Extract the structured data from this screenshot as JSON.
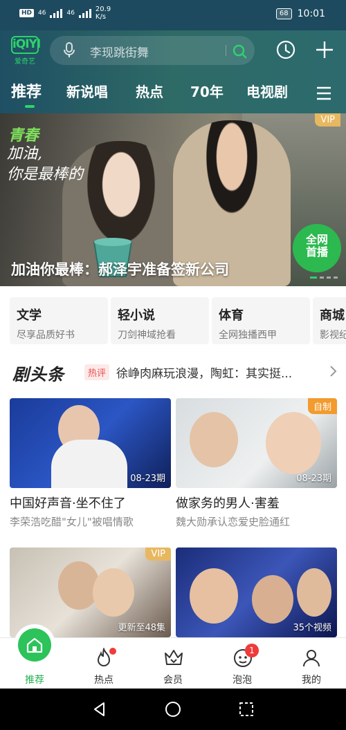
{
  "status_bar": {
    "hd": "HD",
    "sim1": "46",
    "sim2": "46",
    "net_speed_value": "20.9",
    "net_speed_unit": "K/s",
    "battery": "68",
    "time": "10:01"
  },
  "header": {
    "logo_mark": "iQIYI",
    "logo_caption": "爱奇艺",
    "search_placeholder": "李现跳街舞",
    "tabs": [
      {
        "label": "推荐",
        "active": true
      },
      {
        "label": "新说唱"
      },
      {
        "label": "热点"
      },
      {
        "label": "70年"
      },
      {
        "label": "电视剧"
      }
    ]
  },
  "banner": {
    "show_logo": "青春",
    "slogan_line1": "加油,",
    "slogan_line2": "你是最棒的",
    "vip": "VIP",
    "stamp_line1": "全网",
    "stamp_line2": "首播",
    "title": "加油你最棒：郝泽宇准备签新公司"
  },
  "channels": [
    {
      "title": "文学",
      "subtitle": "尽享品质好书"
    },
    {
      "title": "轻小说",
      "subtitle": "刀剑神域抢看"
    },
    {
      "title": "体育",
      "subtitle": "全网独播西甲"
    },
    {
      "title": "商城",
      "subtitle": "影视纪"
    }
  ],
  "headline": {
    "brand": "剧头条",
    "tag": "热评",
    "text": "徐峥肉麻玩浪漫，陶虹：其实挺..."
  },
  "videos": [
    {
      "title": "中国好声音·坐不住了",
      "subtitle": "李荣浩吃醋\"女儿\"被唱情歌",
      "overlay": "08-23期",
      "badge": ""
    },
    {
      "title": "做家务的男人·害羞",
      "subtitle": "魏大勋承认恋爱史脸通红",
      "overlay": "08-23期",
      "badge": "自制"
    },
    {
      "title": "",
      "subtitle": "",
      "overlay": "更新至48集",
      "badge": "VIP"
    },
    {
      "title": "",
      "subtitle": "",
      "overlay": "35个视频",
      "badge": ""
    }
  ],
  "bottom_nav": [
    {
      "label": "推荐",
      "icon": "home-icon",
      "active": true
    },
    {
      "label": "热点",
      "icon": "flame-icon",
      "dot": true
    },
    {
      "label": "会员",
      "icon": "crown-icon"
    },
    {
      "label": "泡泡",
      "icon": "bubble-face-icon",
      "count": "1"
    },
    {
      "label": "我的",
      "icon": "user-icon"
    }
  ],
  "colors": {
    "accent": "#2cd36b",
    "header_bg": "#1f4f63",
    "vip_gold": "#e7b860",
    "hot_red": "#e8504a",
    "self_made_orange": "#f29b2e"
  }
}
